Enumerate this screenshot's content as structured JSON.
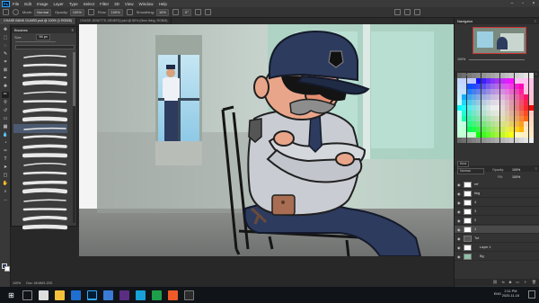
{
  "app": {
    "logo": "Ps",
    "menu": [
      "File",
      "Edit",
      "Image",
      "Layer",
      "Type",
      "Select",
      "Filter",
      "3D",
      "View",
      "Window",
      "Help"
    ]
  },
  "options": {
    "mode_label": "Mode:",
    "mode_value": "Normal",
    "opacity_label": "Opacity:",
    "opacity_value": "100%",
    "flow_label": "Flow:",
    "flow_value": "100%",
    "smoothing_label": "Smoothing:",
    "smoothing_value": "10%",
    "angle_value": "0°"
  },
  "tabs": [
    {
      "label": "CHASE BANK GUARD.psd @ 100% (1 RGB/8)",
      "active": true
    },
    {
      "label": "CHASE JENETTE-SENERQ.psd @ 80% (New thing, RGB/8)",
      "active": false
    }
  ],
  "brushes": {
    "title": "Brushes",
    "size_label": "Size:",
    "size_value": "50 px",
    "rows": [
      "",
      "",
      "",
      "",
      "",
      "",
      "",
      "",
      "",
      "",
      "",
      "",
      "",
      "",
      "",
      "",
      "",
      "",
      "",
      ""
    ]
  },
  "navigator": {
    "title": "Navigator",
    "zoom": "100%"
  },
  "swatches": {
    "title": "Swatches"
  },
  "layers": {
    "title": "Layers",
    "kind_label": "Kind",
    "blend_value": "Normal",
    "opacity_label": "Opacity:",
    "opacity_value": "100%",
    "fill_label": "Fill:",
    "fill_value": "100%",
    "items": [
      {
        "name": "ref",
        "selected": false
      },
      {
        "name": "bkg",
        "selected": false
      },
      {
        "name": "4",
        "selected": false
      },
      {
        "name": "3",
        "selected": false
      },
      {
        "name": "2",
        "selected": false
      },
      {
        "name": "1",
        "selected": true
      },
      {
        "name": "Tut",
        "selected": false
      },
      {
        "name": "Layer 1",
        "selected": false
      },
      {
        "name": "Bg",
        "selected": false
      }
    ]
  },
  "statusbar": {
    "zoom": "100%",
    "doc": "Doc: 48.6M/1.20G"
  },
  "taskbar": {
    "time": "2:11 PM",
    "date": "2020-11-16",
    "lang": "ENG"
  },
  "colors": {
    "ps_blue": "#31a8ff",
    "uniform": "#2d3b5e",
    "shirt": "#c9ccd2",
    "window_sky": "#8ec9e6"
  }
}
